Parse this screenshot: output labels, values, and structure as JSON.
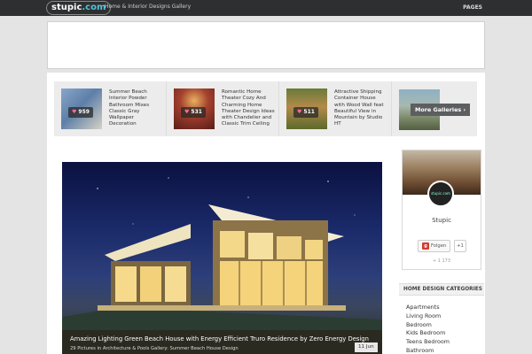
{
  "header": {
    "logo_text": "stupic",
    "logo_tld": ".com",
    "tagline": "Home & Interior Designs Gallery",
    "pages_label": "PAGES"
  },
  "strip": {
    "items": [
      {
        "title": "Summer Beach Interior Powder Bathroom Mixes Classic Gray Wallpaper Decoration",
        "count": "959",
        "thumb_color": "#5d7fa8"
      },
      {
        "title": "Romantic Home Theater Cozy And Charming Home Theater Design Ideas with Chandelier and Classic Trim Ceiling",
        "count": "531",
        "thumb_color": "#7a2a22"
      },
      {
        "title": "Attractive Shipping Container House with Wood Wall feat Beautiful View in Mountain by Studio HT",
        "count": "511",
        "thumb_color": "#8a6a3a"
      }
    ],
    "more_label": "More Galleries ›"
  },
  "featured": {
    "title": "Amazing Lighting Green Beach House with Energy Efficient Truro Residence by Zero Energy Design",
    "subtitle": "29 Pictures in Architecture & Pools Gallery: Summer Beach House Design",
    "date": "11 Jun"
  },
  "sidebar": {
    "profile": {
      "avatar_text": "stupic.com",
      "name": "Stupic",
      "follow_label": "Folgen",
      "plusone_label": "+1",
      "count": "+ 1 173"
    },
    "categories": {
      "heading": "HOME DESIGN CATEGORIES",
      "items": [
        "Apartments",
        "Living Room",
        "Bedroom",
        "Kids Bedroom",
        "Teens Bedroom",
        "Bathroom"
      ]
    }
  },
  "colors": {
    "accent": "#52c3d8",
    "topbar": "#2e2f31",
    "heart": "#ff6f91"
  }
}
